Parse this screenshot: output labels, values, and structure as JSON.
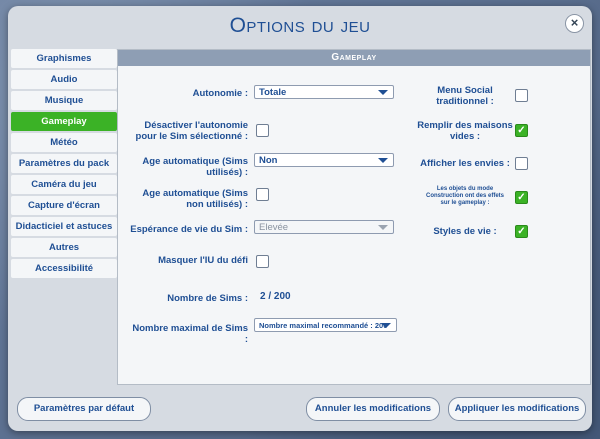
{
  "dialog": {
    "title": "Options du jeu",
    "close_symbol": "×"
  },
  "sidebar": {
    "items": [
      {
        "label": "Graphismes"
      },
      {
        "label": "Audio"
      },
      {
        "label": "Musique"
      },
      {
        "label": "Gameplay",
        "active": true
      },
      {
        "label": "Météo"
      },
      {
        "label": "Paramètres du pack"
      },
      {
        "label": "Caméra du jeu"
      },
      {
        "label": "Capture d'écran"
      },
      {
        "label": "Didacticiel et astuces"
      },
      {
        "label": "Autres"
      },
      {
        "label": "Accessibilité"
      }
    ]
  },
  "panel": {
    "header": "Gameplay",
    "left": {
      "autonomy_label": "Autonomie :",
      "autonomy_value": "Totale",
      "disable_autonomy_label": "Désactiver l'autonomie pour le Sim sélectionné :",
      "disable_autonomy_checked": false,
      "auto_age_used_label": "Age automatique (Sims utilisés) :",
      "auto_age_used_value": "Non",
      "auto_age_unused_label": "Age automatique (Sims non utilisés) :",
      "auto_age_unused_checked": false,
      "lifespan_label": "Espérance de vie du Sim :",
      "lifespan_value": "Elevée",
      "hide_challenge_ui_label": "Masquer l'IU du défi",
      "hide_challenge_ui_checked": false,
      "sims_count_label": "Nombre de Sims :",
      "sims_count_value": "2  /  200",
      "max_sims_label": "Nombre maximal de Sims :",
      "max_sims_value": "Nombre maximal recommandé : 200"
    },
    "right": {
      "social_menu_label": "Menu Social traditionnel :",
      "social_menu_checked": false,
      "fill_houses_label": "Remplir des maisons vides :",
      "fill_houses_checked": true,
      "show_wants_label": "Afficher les envies :",
      "show_wants_checked": false,
      "build_mode_label": "Les objets du mode Construction ont des effets sur le gameplay :",
      "build_mode_checked": true,
      "lifestyles_label": "Styles de vie :",
      "lifestyles_checked": true
    }
  },
  "footer": {
    "defaults_label": "Paramètres par défaut",
    "cancel_label": "Annuler les modifications",
    "apply_label": "Appliquer les modifications"
  },
  "colors": {
    "accent": "#3bb226",
    "text": "#1f4f94",
    "header": "#8e9eb4"
  }
}
